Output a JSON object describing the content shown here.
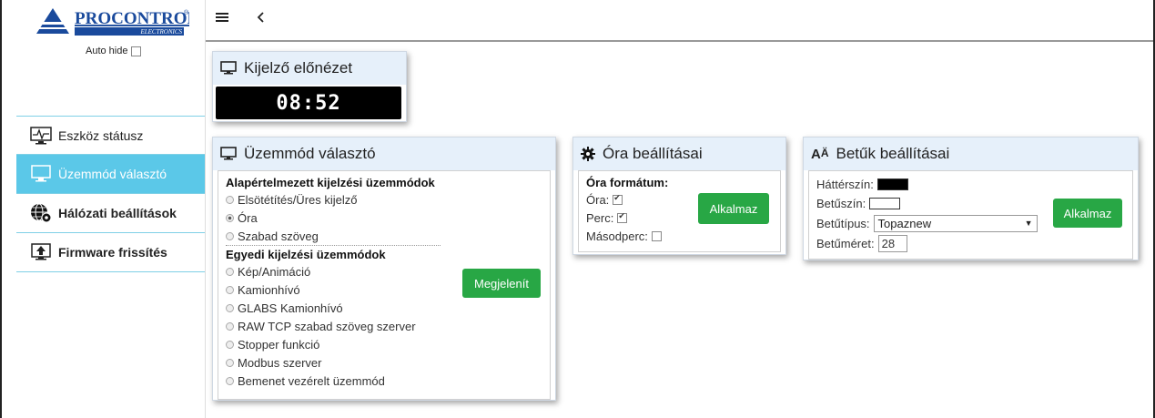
{
  "brand": {
    "name": "PROCONTROL",
    "tagline": "ELECTRONICS",
    "reg": "®"
  },
  "sidebar": {
    "auto_hide_label": "Auto hide",
    "auto_hide_checked": false,
    "items": [
      {
        "label": "Eszköz státusz",
        "icon": "monitor-heartbeat-icon",
        "active": false
      },
      {
        "label": "Üzemmód választó",
        "icon": "monitor-icon",
        "active": true
      },
      {
        "label": "Hálózati beállítások",
        "icon": "globe-gear-icon",
        "active": false
      },
      {
        "label": "Firmware frissítés",
        "icon": "monitor-upload-icon",
        "active": false
      }
    ]
  },
  "topbar": {
    "menu_icon": "hamburger-icon",
    "back_icon": "chevron-left-icon"
  },
  "preview": {
    "title": "Kijelző előnézet",
    "clock": "08:52"
  },
  "mode": {
    "title": "Üzemmód választó",
    "default_title": "Alapértelmezett kijelzési üzemmódok",
    "default_options": [
      {
        "label": "Elsötétítés/Üres kijelző",
        "selected": false
      },
      {
        "label": "Óra",
        "selected": true
      },
      {
        "label": "Szabad szöveg",
        "selected": false
      }
    ],
    "custom_title": "Egyedi kijelzési üzemmódok",
    "custom_options": [
      {
        "label": "Kép/Animáció",
        "selected": false
      },
      {
        "label": "Kamionhívó",
        "selected": false
      },
      {
        "label": "GLABS Kamionhívó",
        "selected": false
      },
      {
        "label": "RAW TCP szabad szöveg szerver",
        "selected": false
      },
      {
        "label": "Stopper funkció",
        "selected": false
      },
      {
        "label": "Modbus szerver",
        "selected": false
      },
      {
        "label": "Bemenet vezérelt üzemmód",
        "selected": false
      }
    ],
    "button": "Megjelenít"
  },
  "clock_settings": {
    "title": "Óra beállításai",
    "format_title": "Óra formátum:",
    "hour_label": "Óra:",
    "hour_checked": true,
    "minute_label": "Perc:",
    "minute_checked": true,
    "second_label": "Másodperc:",
    "second_checked": false,
    "button": "Alkalmaz"
  },
  "font_settings": {
    "title": "Betűk beállításai",
    "bg_label": "Háttérszín:",
    "bg_color": "#000000",
    "fg_label": "Betűszín:",
    "fg_color": "#ffffff",
    "font_label": "Betűtípus:",
    "font_value": "Topaznew",
    "size_label": "Betűméret:",
    "size_value": "28",
    "button": "Alkalmaz"
  },
  "colors": {
    "accent": "#5bc8e8",
    "button": "#28a745",
    "panel_header": "#e6f0fa"
  }
}
